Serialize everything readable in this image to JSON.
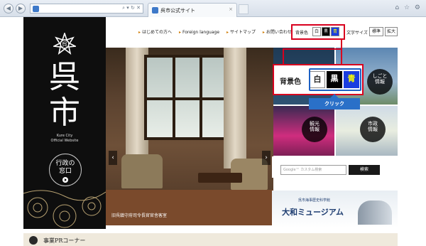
{
  "browser": {
    "back_glyph": "◀",
    "forward_glyph": "▶",
    "address_controls": "⌕ ▾ ↻ ✕",
    "tab_title": "呉市公式サイト",
    "tab_close": "×",
    "toolbar_glyphs": "⌂ ☆ ⚙"
  },
  "site": {
    "logo_kanji_1": "呉",
    "logo_kanji_2": "市",
    "logo_en_1": "Kure City",
    "logo_en_2": "Official Website",
    "admin_button_1": "行政の",
    "admin_button_2": "窓口"
  },
  "topnav": {
    "items": [
      "はじめての方へ",
      "Foreign language",
      "サイトマップ",
      "お問い合わせ"
    ],
    "arrow": "▸"
  },
  "style_tools": {
    "bg_label": "背景色",
    "bg_white": "白",
    "bg_black": "黒",
    "bg_blue": "青",
    "text_size_label": "文字サイズ",
    "text_standard": "標準",
    "text_large": "拡大"
  },
  "hero": {
    "caption": "旧呉鎮守府司令長官官舎客室",
    "prev": "‹",
    "next": "›"
  },
  "panels": [
    {
      "line1": "しごと",
      "line2": "情報"
    },
    {
      "line1": "観光",
      "line2": "情報"
    },
    {
      "line1": "市政",
      "line2": "情報"
    }
  ],
  "search": {
    "placeholder": "Google™ カスタム検索",
    "button": "検索"
  },
  "museum": {
    "sub": "呉市海事歴史科学館",
    "title": "大和ミュージアム"
  },
  "pr_bar": {
    "title": "事業PRコーナー"
  },
  "callout": {
    "label": "背景色",
    "white": "白",
    "black": "黒",
    "blue": "青",
    "click": "クリック"
  }
}
